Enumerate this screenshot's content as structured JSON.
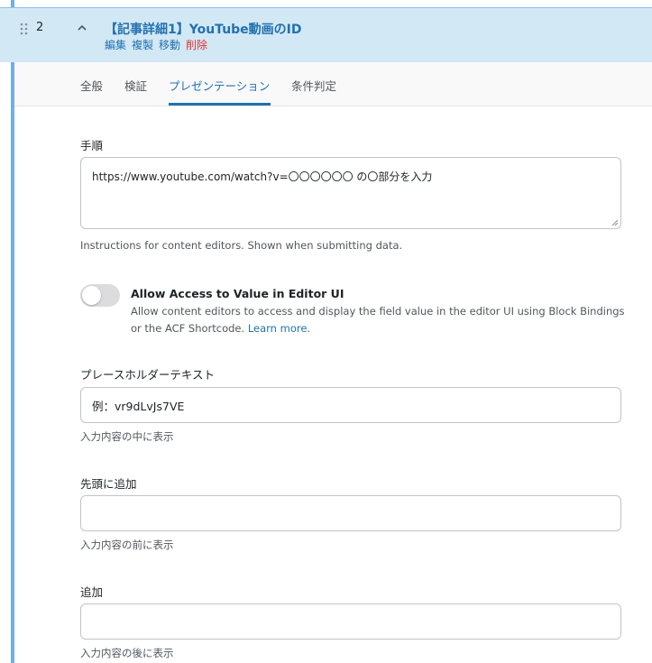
{
  "field": {
    "order": "2",
    "title": "【記事詳細1】YouTube動画のID",
    "actions": {
      "edit": "編集",
      "duplicate": "複製",
      "move": "移動",
      "delete": "削除"
    }
  },
  "tabs": [
    {
      "label": "全般"
    },
    {
      "label": "検証"
    },
    {
      "label": "プレゼンテーション"
    },
    {
      "label": "条件判定"
    }
  ],
  "instructions": {
    "label": "手順",
    "value": "https://www.youtube.com/watch?v=〇〇〇〇〇〇 の〇部分を入力",
    "hint": "Instructions for content editors. Shown when submitting data."
  },
  "editor_access": {
    "title": "Allow Access to Value in Editor UI",
    "description": "Allow content editors to access and display the field value in the editor UI using Block Bindings or the ACF Shortcode.",
    "link": "Learn more.",
    "enabled": false
  },
  "placeholder": {
    "label": "プレースホルダーテキスト",
    "value": "例：vr9dLvJs7VE",
    "hint": "入力内容の中に表示"
  },
  "prepend": {
    "label": "先頭に追加",
    "value": "",
    "hint": "入力内容の前に表示"
  },
  "append": {
    "label": "追加",
    "value": "",
    "hint": "入力内容の後に表示"
  },
  "colors": {
    "accent": "#2271b1",
    "header_bg": "#d3e8f5",
    "left_bar": "#72aee6",
    "danger": "#d63638"
  }
}
